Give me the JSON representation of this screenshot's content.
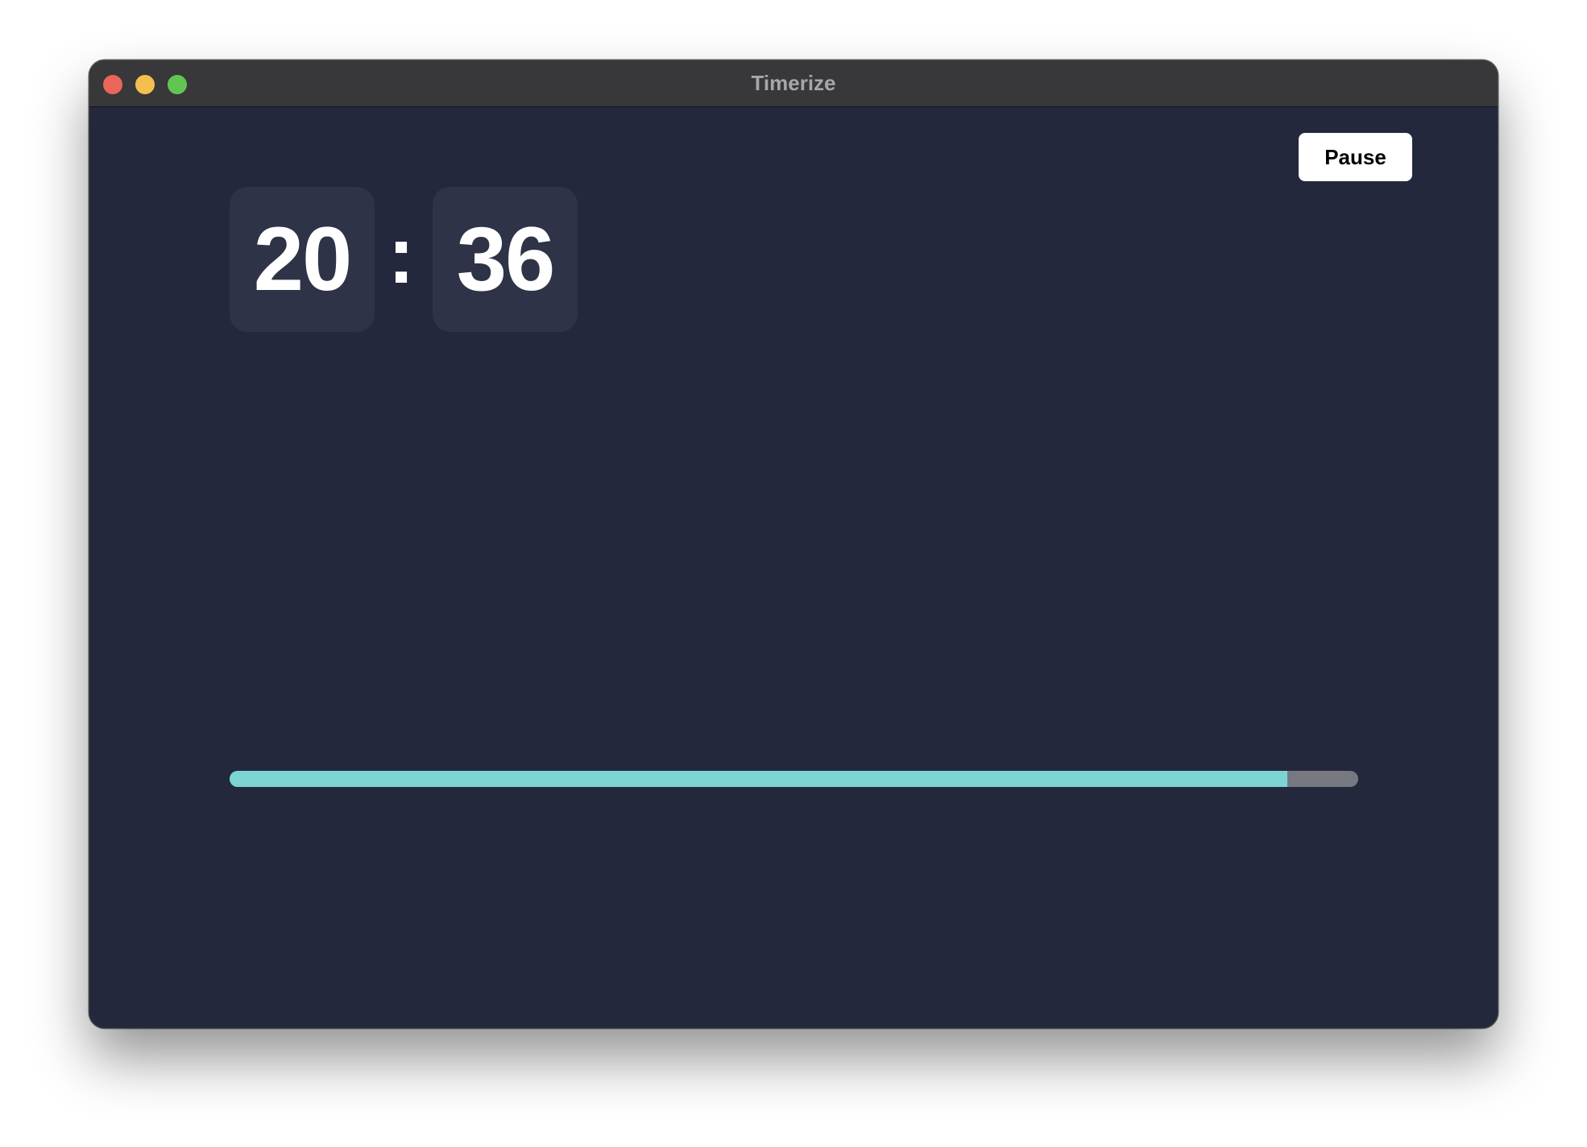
{
  "window": {
    "title": "Timerize"
  },
  "traffic_lights": {
    "close_color": "#ec6559",
    "minimize_color": "#f5bf4f",
    "zoom_color": "#61c554"
  },
  "controls": {
    "pause_label": "Pause"
  },
  "timer": {
    "minutes": "20",
    "separator": ":",
    "seconds": "36"
  },
  "progress": {
    "fraction": 0.937,
    "fill_color": "#7dd5d3",
    "track_color": "#777882"
  },
  "theme": {
    "background": "#23283d",
    "digit_box": "#2f3347"
  }
}
